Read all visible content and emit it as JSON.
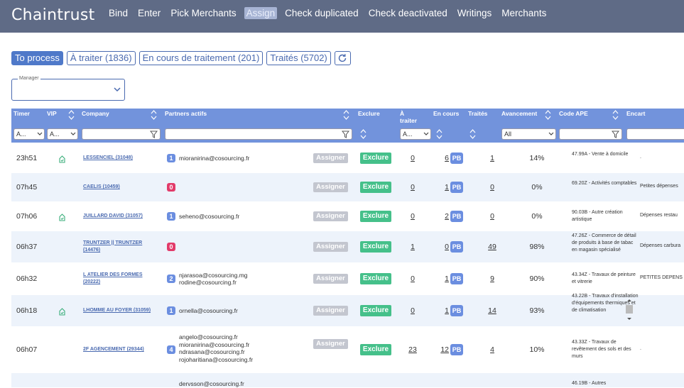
{
  "app": {
    "title": "Chaintrust"
  },
  "nav": [
    {
      "label": "Bind",
      "active": false
    },
    {
      "label": "Enter",
      "active": false
    },
    {
      "label": "Pick Merchants",
      "active": false
    },
    {
      "label": "Assign",
      "active": true
    },
    {
      "label": "Check duplicated",
      "active": false
    },
    {
      "label": "Check deactivated",
      "active": false
    },
    {
      "label": "Writings",
      "active": false
    },
    {
      "label": "Merchants",
      "active": false
    }
  ],
  "tabs": [
    {
      "label": "To process",
      "active": true
    },
    {
      "label": "À traiter (1836)",
      "active": false
    },
    {
      "label": "En cours de traitement (201)",
      "active": false
    },
    {
      "label": "Traités (5702)",
      "active": false
    }
  ],
  "manager": {
    "label": "Manager",
    "value": ""
  },
  "columns": {
    "timer": "Timer",
    "vip": "VIP",
    "company": "Company",
    "partners": "Partners actifs",
    "exclure": "Exclure",
    "a_traiter": "À traiter",
    "en_cours": "En cours",
    "traites": "Traités",
    "avancement": "Avancement",
    "code_ape": "Code APE",
    "encart": "Encart"
  },
  "filters": {
    "timer": "A...",
    "vip": "A...",
    "a_traiter": "A...",
    "avancement": "All"
  },
  "buttons": {
    "assign": "Assigner",
    "exclude": "Exclure",
    "pb": "PB"
  },
  "rows": [
    {
      "timer": "23h51",
      "vip": true,
      "company": "LESSENCIEL (31048)",
      "badge": "1",
      "badge_color": "blue",
      "emails": [
        "mioranirina@cosourcing.fr"
      ],
      "a_traiter": "0",
      "en_cours": "6",
      "traites": "1",
      "avancement": "14%",
      "ape": "47.99A - Vente à domicile",
      "encart": "."
    },
    {
      "timer": "07h45",
      "vip": false,
      "company": "CAELIS (10459)",
      "badge": "0",
      "badge_color": "red",
      "emails": [],
      "a_traiter": "0",
      "en_cours": "1",
      "traites": "0",
      "avancement": "0%",
      "ape": "69.20Z - Activités comptables",
      "encart": "Petites dépenses"
    },
    {
      "timer": "07h06",
      "vip": true,
      "company": "JUILLARD DAVID (31057)",
      "badge": "1",
      "badge_color": "blue",
      "emails": [
        "seheno@cosourcing.fr"
      ],
      "a_traiter": "0",
      "en_cours": "2",
      "traites": "0",
      "avancement": "0%",
      "ape": "90.03B - Autre création artistique",
      "encart": "Dépenses restau"
    },
    {
      "timer": "06h37",
      "vip": false,
      "company": "TRUNTZER || TRUNTZER (14476)",
      "badge": "0",
      "badge_color": "red",
      "emails": [],
      "a_traiter": "1",
      "en_cours": "0",
      "traites": "49",
      "avancement": "98%",
      "ape": "47.26Z - Commerce de détail de produits à base de tabac en magasin spécialisé",
      "encart": "Dépenses carbura"
    },
    {
      "timer": "06h32",
      "vip": false,
      "company": "L ATELIER DES FORMES (20222)",
      "badge": "2",
      "badge_color": "blue",
      "emails": [
        "njarasoa@cosourcing.mg",
        "rodine@cosourcing.fr"
      ],
      "a_traiter": "0",
      "en_cours": "1",
      "traites": "9",
      "avancement": "90%",
      "ape": "43.34Z - Travaux de peinture et vitrerie",
      "encart": "PETITES DEPENS"
    },
    {
      "timer": "06h18",
      "vip": true,
      "company": "LHOMME AU FOYER (31059)",
      "badge": "1",
      "badge_color": "blue",
      "emails": [
        "ornella@cosourcing.fr"
      ],
      "a_traiter": "0",
      "en_cours": "1",
      "traites": "14",
      "avancement": "93%",
      "ape": "43.22B - Travaux d'installation d'équipements thermiques et de climatisation",
      "encart": ""
    },
    {
      "timer": "06h07",
      "vip": false,
      "company": "2F AGENCEMENT (29344)",
      "badge": "4",
      "badge_color": "blue",
      "emails": [
        "angelo@cosourcing.fr",
        "mioranirina@cosourcing.fr",
        "ndrasana@cosourcing.fr",
        "rojoharitiana@cosourcing.fr"
      ],
      "a_traiter": "23",
      "en_cours": "12",
      "traites": "4",
      "avancement": "10%",
      "ape": "43.33Z - Travaux de revêtement des sols et des murs",
      "encart": "."
    },
    {
      "timer": "",
      "vip": false,
      "company": "",
      "badge": "",
      "badge_color": "blue",
      "emails": [
        "dervsson@cosourcing.fr"
      ],
      "a_traiter": "",
      "en_cours": "",
      "traites": "",
      "avancement": "",
      "ape": "46.19B - Autres",
      "encart": ""
    }
  ],
  "colors": {
    "nav_bg": "#5f6b86",
    "header_bg": "#7293dc",
    "accent": "#4f79c9",
    "exclude_green": "#45c08a",
    "badge_red": "#e23b6a",
    "alt_row": "#edf3fb"
  }
}
